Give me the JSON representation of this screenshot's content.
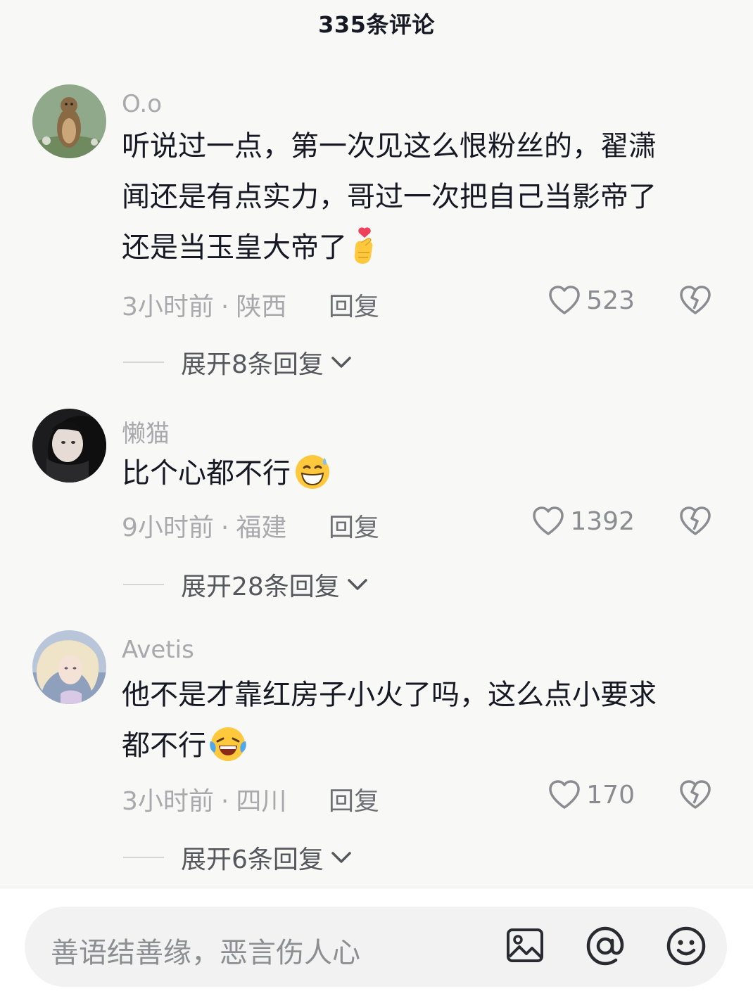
{
  "header": {
    "title": "335条评论"
  },
  "comments": [
    {
      "username": "O.o",
      "avatar": "marmot-photo",
      "lines": [
        "听说过一点，第一次见这么恨粉丝的，翟潇",
        "闻还是有点实力，哥过一次把自己当影帝了",
        "还是当玉皇大帝了"
      ],
      "emoji": "finger-heart-emoji",
      "time": "3小时前",
      "location": "陕西",
      "reply_label": "回复",
      "likes": "523",
      "expand_label": "展开8条回复"
    },
    {
      "username": "懒猫",
      "avatar": "girl-photo-dark",
      "lines": [
        "比个心都不行"
      ],
      "emoji": "grin-sweat-emoji",
      "time": "9小时前",
      "location": "福建",
      "reply_label": "回复",
      "likes": "1392",
      "expand_label": "展开28条回复"
    },
    {
      "username": "Avetis",
      "avatar": "girl-photo-light",
      "lines": [
        "他不是才靠红房子小火了吗，这么点小要求",
        "都不行"
      ],
      "emoji": "crying-laughing-emoji",
      "time": "3小时前",
      "location": "四川",
      "reply_label": "回复",
      "likes": "170",
      "expand_label": "展开6条回复"
    }
  ],
  "input": {
    "placeholder": "善语结善缘，恶言伤人心"
  },
  "bar_icons": [
    "image-icon",
    "at-icon",
    "emoji-icon"
  ],
  "colors": {
    "text": "#161823",
    "muted": "#a8a8ad",
    "background": "#f8f8f6"
  }
}
